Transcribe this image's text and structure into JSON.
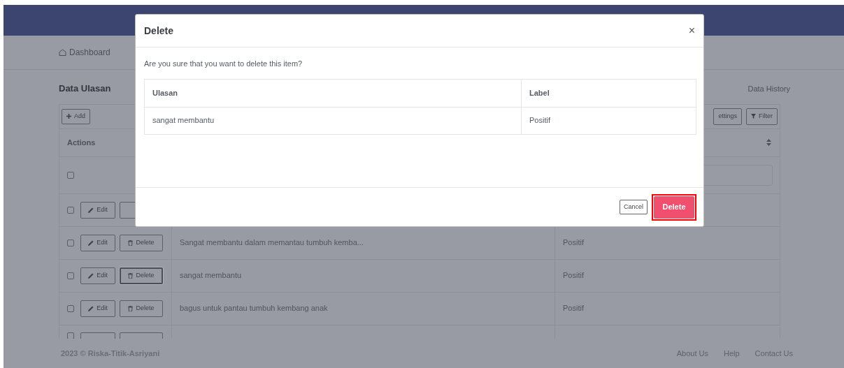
{
  "breadcrumb": {
    "label": "Dashboard"
  },
  "page_title": "Data Ulasan",
  "history_link": "Data History",
  "toolbar": {
    "add": "Add",
    "settings": "ettings",
    "filter": "Filter"
  },
  "table": {
    "actions_heading": "Actions",
    "select_all_checked": false,
    "rows": [
      {
        "checked": false,
        "edit": "Edit",
        "focused": false
      },
      {
        "checked": false,
        "edit": "Edit",
        "delete": "Delete",
        "ulasan": "Sangat membantu dalam memantau tumbuh kemba...",
        "label": "Positif",
        "focused": false
      },
      {
        "checked": false,
        "edit": "Edit",
        "delete": "Delete",
        "ulasan": "sangat membantu",
        "label": "Positif",
        "focused": true
      },
      {
        "checked": false,
        "edit": "Edit",
        "delete": "Delete",
        "ulasan": "bagus untuk pantau tumbuh kembang anak",
        "label": "Positif",
        "focused": false
      },
      {
        "checked": false,
        "focused": false
      }
    ]
  },
  "footer": {
    "copyright": "2023 © Riska-Titik-Asriyani",
    "links": [
      "About Us",
      "Help",
      "Contact Us"
    ]
  },
  "dialog": {
    "title": "Delete",
    "close": "×",
    "message": "Are you sure that you want to delete this item?",
    "columns": [
      "Ulasan",
      "Label"
    ],
    "rows": [
      [
        "sangat membantu",
        "Positif"
      ]
    ],
    "cancel": "Cancel",
    "confirm": "Delete",
    "confirm_highlighted": true
  }
}
